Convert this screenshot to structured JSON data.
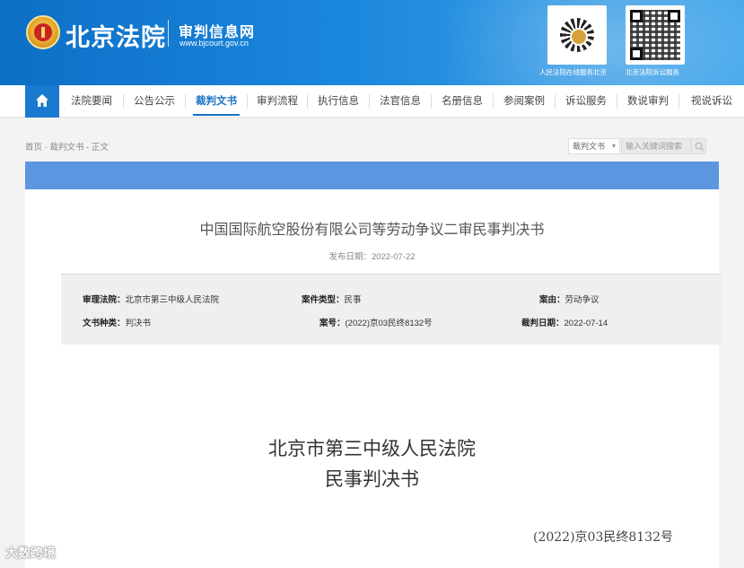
{
  "header": {
    "site_name": "北京法院",
    "sub_title": "审判信息网",
    "url": "www.bjcourt.gov.cn",
    "qr_labels": [
      "人民法院在线服务北京",
      "北京法院诉讼服务"
    ]
  },
  "nav": {
    "items": [
      "法院要闻",
      "公告公示",
      "裁判文书",
      "审判流程",
      "执行信息",
      "法官信息",
      "名册信息",
      "参阅案例",
      "诉讼服务",
      "数说审判",
      "视说诉讼"
    ],
    "active": "裁判文书"
  },
  "breadcrumb": "首页 - 裁判文书 - 正文",
  "search": {
    "category": "裁判文书",
    "placeholder": "输入关键词搜索"
  },
  "document": {
    "title": "中国国际航空股份有限公司等劳动争议二审民事判决书",
    "publish_date": "发布日期：2022-07-22",
    "info": {
      "court_label": "审理法院：",
      "court_value": "北京市第三中级人民法院",
      "case_type_label": "案件类型：",
      "case_type_value": "民事",
      "cause_label": "案由：",
      "cause_value": "劳动争议",
      "doc_type_label": "文书种类：",
      "doc_type_value": "判决书",
      "case_no_label": "案号：",
      "case_no_value": "(2022)京03民终8132号",
      "judge_date_label": "裁判日期：",
      "judge_date_value": "2022-07-14"
    },
    "court_name": "北京市第三中级人民法院",
    "doc_kind": "民事判决书",
    "case_number": "(2022)京03民终8132号"
  },
  "watermark": "大数跨境",
  "colors": {
    "header_blue": "#1a86dc",
    "nav_active": "#1a6fc4",
    "band_blue": "#5c96e0"
  }
}
